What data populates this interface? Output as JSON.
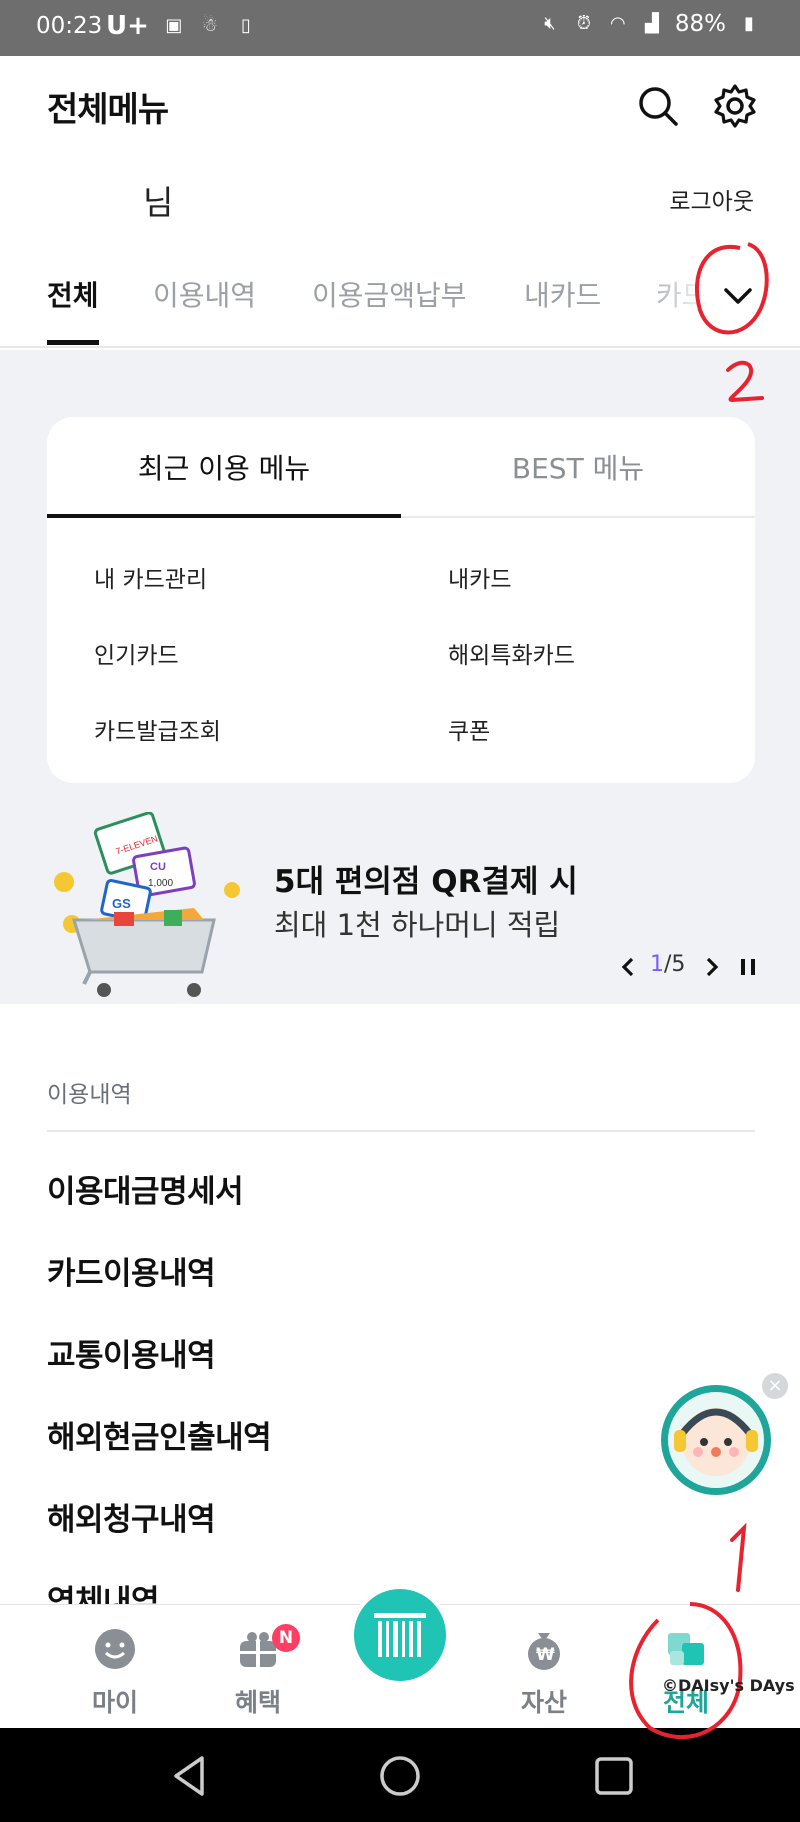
{
  "status_bar": {
    "time": "00:23",
    "carrier": "U+",
    "battery": "88%",
    "left_icons": [
      "gallery-icon",
      "notification-icon",
      "sd-icon"
    ],
    "right_icons": [
      "mute-icon",
      "alarm-icon",
      "wifi-icon",
      "signal-icon",
      "battery-icon"
    ]
  },
  "header": {
    "title": "전체메뉴",
    "search_icon": "search-icon",
    "settings_icon": "gear-icon"
  },
  "user": {
    "name_suffix": "님",
    "logout_label": "로그아웃"
  },
  "tabs": {
    "items": [
      {
        "label": "전체",
        "active": true
      },
      {
        "label": "이용내역",
        "active": false
      },
      {
        "label": "이용금액납부",
        "active": false
      },
      {
        "label": "내카드",
        "active": false
      },
      {
        "label": "카드",
        "active": false
      }
    ],
    "expand_icon": "chevron-down-icon"
  },
  "menu_card": {
    "tabs": [
      {
        "label": "최근 이용 메뉴",
        "active": true
      },
      {
        "label": "BEST 메뉴",
        "active": false
      }
    ],
    "items": [
      "내 카드관리",
      "내카드",
      "인기카드",
      "해외특화카드",
      "카드발급조회",
      "쿠폰"
    ]
  },
  "banner": {
    "title": "5대 편의점 QR결제 시",
    "subtitle": "최대 1천 하나머니 적립",
    "image_labels": [
      "7-ELEVEN",
      "CU",
      "1,000",
      "GS"
    ],
    "pager": {
      "current": "1",
      "separator": "/",
      "total": "5"
    }
  },
  "usage_section": {
    "label": "이용내역",
    "items": [
      "이용대금명세서",
      "카드이용내역",
      "교통이용내역",
      "해외현금인출내역",
      "해외청구내역",
      "연체내역"
    ]
  },
  "bottom_nav": {
    "items": [
      {
        "label": "마이",
        "icon": "smile-icon"
      },
      {
        "label": "혜택",
        "icon": "gift-icon",
        "badge": "N"
      },
      {
        "label": "",
        "icon": "barcode-icon"
      },
      {
        "label": "자산",
        "icon": "money-bag-icon"
      },
      {
        "label": "전체",
        "icon": "all-menu-icon"
      }
    ]
  },
  "annotations": {
    "marks": [
      "1",
      "2"
    ],
    "watermark": "©DAIsy's DAys"
  },
  "colors": {
    "accent": "#1fc4b4",
    "badge": "#ff3e63",
    "annotation": "#e8232f",
    "pager_current": "#7a5cff",
    "background_gray": "#f0f2f5"
  }
}
